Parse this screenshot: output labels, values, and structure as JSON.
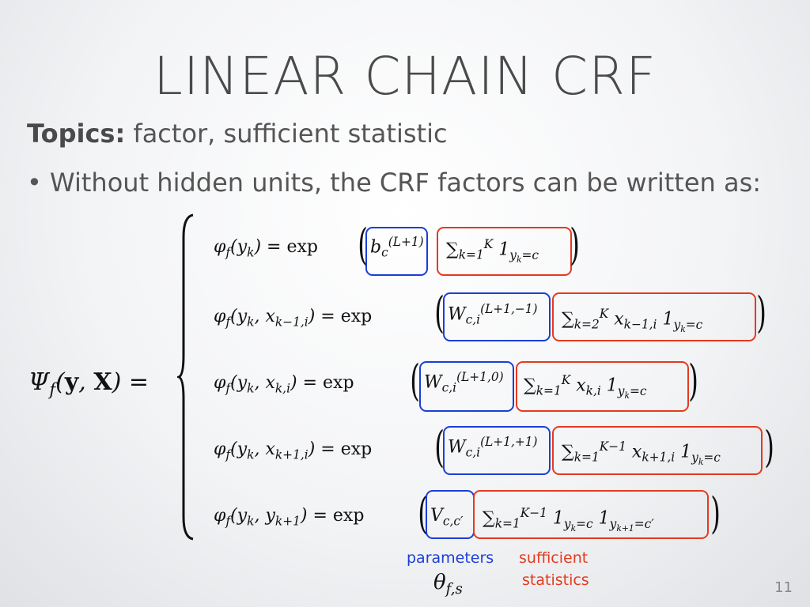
{
  "slide": {
    "title": "LINEAR CHAIN CRF",
    "topics_label": "Topics:",
    "topics_text": "factor, sufficient statistic",
    "bullet": "• Without hidden units, the CRF factors can be written as:",
    "lhs": "Ψf(y, X) =",
    "equations": [
      {
        "lhs": "φf(yk) = exp",
        "param": "bc(L+1)",
        "stat": "∑k=1K 1yk=c"
      },
      {
        "lhs": "φf(yk, xk−1,i) = exp",
        "param": "Wc,i(L+1,−1)",
        "stat": "∑k=2K xk−1,i 1yk=c"
      },
      {
        "lhs": "φf(yk, xk,i) = exp",
        "param": "Wc,i(L+1,0)",
        "stat": "∑k=1K xk,i 1yk=c"
      },
      {
        "lhs": "φf(yk, xk+1,i) = exp",
        "param": "Wc,i(L+1,+1)",
        "stat": "∑k=1K−1 xk+1,i 1yk=c"
      },
      {
        "lhs": "φf(yk, yk+1) = exp",
        "param": "Vc,c′",
        "stat": "∑k=1K−1 1yk=c 1yk+1=c′"
      }
    ],
    "labels": {
      "parameters": "parameters",
      "sufficient": "sufficient",
      "statistics": "statistics",
      "theta": "θf,s"
    },
    "page_number": "11",
    "colors": {
      "blue": "#1a3fd6",
      "red": "#e43a1f"
    }
  }
}
